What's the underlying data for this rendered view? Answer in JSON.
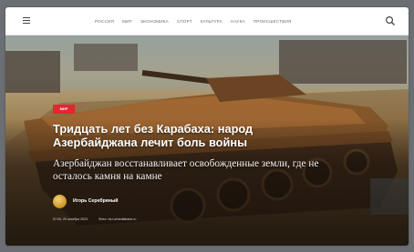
{
  "header": {
    "menu_icon": "hamburger-menu-icon",
    "nav_items": [
      "Россия",
      "Мир",
      "Экономика",
      "Спорт",
      "Культура",
      "Наука",
      "Происшествия"
    ],
    "search_icon": "search-icon"
  },
  "article": {
    "badge": "Мир",
    "badge_color": "#e3262f",
    "title": "Тридцать лет без Карабаха: народ Азербайджана лечит боль войны",
    "subtitle": "Азербайджан восстанавливает освобожденные земли, где не осталось камня на камне",
    "author": "Игорь Серебряный",
    "date": "07:00, 29 октября 2023",
    "photo_credit": "Фото: ria.ru/mediabank.ru"
  }
}
